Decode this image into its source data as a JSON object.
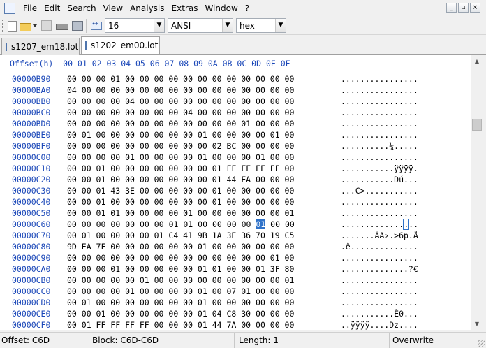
{
  "menu": [
    "File",
    "Edit",
    "Search",
    "View",
    "Analysis",
    "Extras",
    "Window",
    "?"
  ],
  "window_controls": [
    "_",
    "▫",
    "×"
  ],
  "toolbar": {
    "bytes_per_row": "16",
    "charset": "ANSI",
    "mode": "hex"
  },
  "tabs": [
    {
      "label": "s1207_em18.lot",
      "active": false
    },
    {
      "label": "s1202_em00.lot",
      "active": true
    }
  ],
  "editor": {
    "header": "Offset(h)  00 01 02 03 04 05 06 07 08 09 0A 0B 0C 0D 0E 0F",
    "rows": [
      {
        "offset": "00000B90",
        "hex": "00 00 00 01 00 00 00 00 00 00 00 00 00 00 00 00",
        "ascii": "................"
      },
      {
        "offset": "00000BA0",
        "hex": "04 00 00 00 00 00 00 00 00 00 00 00 00 00 00 00",
        "ascii": "................"
      },
      {
        "offset": "00000BB0",
        "hex": "00 00 00 00 04 00 00 00 00 00 00 00 00 00 00 00",
        "ascii": "................"
      },
      {
        "offset": "00000BC0",
        "hex": "00 00 00 00 00 00 00 00 04 00 00 00 00 00 00 00",
        "ascii": "................"
      },
      {
        "offset": "00000BD0",
        "hex": "00 00 00 00 00 00 00 00 00 00 00 00 01 00 00 00",
        "ascii": "................"
      },
      {
        "offset": "00000BE0",
        "hex": "00 01 00 00 00 00 00 00 00 01 00 00 00 00 01 00",
        "ascii": "................"
      },
      {
        "offset": "00000BF0",
        "hex": "00 00 00 00 00 00 00 00 00 00 02 BC 00 00 00 00",
        "ascii": "..........¼....."
      },
      {
        "offset": "00000C00",
        "hex": "00 00 00 00 01 00 00 00 00 01 00 00 00 01 00 00",
        "ascii": "................"
      },
      {
        "offset": "00000C10",
        "hex": "00 00 01 00 00 00 00 00 00 00 01 FF FF FF FF 00",
        "ascii": "...........ÿÿÿÿ."
      },
      {
        "offset": "00000C20",
        "hex": "00 00 01 00 00 00 00 00 00 00 01 44 FA 00 00 00",
        "ascii": "...........Dú..."
      },
      {
        "offset": "00000C30",
        "hex": "00 00 01 43 3E 00 00 00 00 00 01 00 00 00 00 00",
        "ascii": "...C>..........."
      },
      {
        "offset": "00000C40",
        "hex": "00 00 01 00 00 00 00 00 00 00 01 00 00 00 00 00",
        "ascii": "................"
      },
      {
        "offset": "00000C50",
        "hex": "00 00 01 01 00 00 00 00 01 00 00 00 00 00 00 01",
        "ascii": "................"
      },
      {
        "offset": "00000C60",
        "hex": "00 00 00 00 00 00 00 01 01 00 00 00 00 01 00 00",
        "ascii": "................",
        "selected_byte": 13
      },
      {
        "offset": "00000C70",
        "hex": "00 01 00 00 00 00 01 C4 41 9B 1A 3E 36 70 19 C5",
        "ascii": ".......ÄA›.>6p.Å"
      },
      {
        "offset": "00000C80",
        "hex": "9D EA 7F 00 00 00 00 00 00 01 00 00 00 00 00 00",
        "ascii": ".ê.............."
      },
      {
        "offset": "00000C90",
        "hex": "00 00 00 00 00 00 00 00 00 00 00 00 00 00 01 00",
        "ascii": "................"
      },
      {
        "offset": "00000CA0",
        "hex": "00 00 00 01 00 00 00 00 00 01 01 00 00 01 3F 80",
        "ascii": "..............?€"
      },
      {
        "offset": "00000CB0",
        "hex": "00 00 00 00 00 01 00 00 00 00 00 00 00 00 00 01",
        "ascii": "................"
      },
      {
        "offset": "00000CC0",
        "hex": "00 00 00 00 01 00 00 00 00 01 00 07 01 00 00 00",
        "ascii": "................"
      },
      {
        "offset": "00000CD0",
        "hex": "00 01 00 00 00 00 00 00 00 01 00 00 00 00 00 00",
        "ascii": "................"
      },
      {
        "offset": "00000CE0",
        "hex": "00 00 01 00 00 00 00 00 00 01 04 C8 30 00 00 00",
        "ascii": "...........È0..."
      },
      {
        "offset": "00000CF0",
        "hex": "00 01 FF FF FF FF 00 00 00 01 44 7A 00 00 00 00",
        "ascii": "..ÿÿÿÿ....Dz...."
      }
    ]
  },
  "status": {
    "offset": "Offset: C6D",
    "block": "Block: C6D-C6D",
    "length": "Length: 1",
    "mode": "Overwrite"
  }
}
